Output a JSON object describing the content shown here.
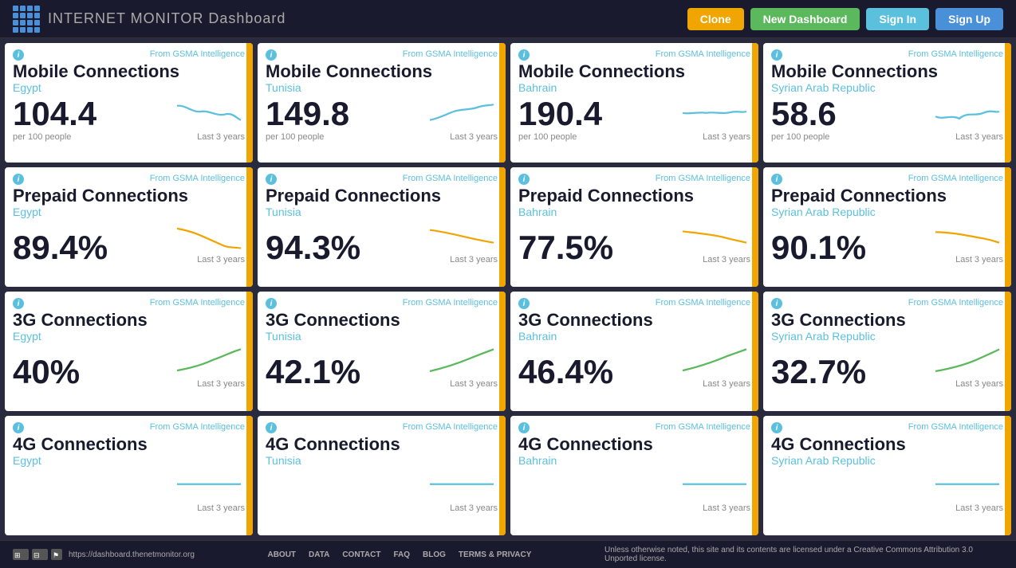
{
  "header": {
    "logo_text": "INTERNET MONITOR",
    "logo_subtitle": " Dashboard",
    "btn_clone": "Clone",
    "btn_new_dashboard": "New Dashboard",
    "btn_sign_in": "Sign In",
    "btn_sign_up": "Sign Up"
  },
  "cards": [
    {
      "source": "From GSMA Intelligence",
      "title": "Mobile Connections",
      "country": "Egypt",
      "value": "104.4",
      "sublabel": "per 100 people",
      "chart_label": "Last 3 years",
      "chart_color": "#5bc0de",
      "chart_type": "wave_down"
    },
    {
      "source": "From GSMA Intelligence",
      "title": "Mobile Connections",
      "country": "Tunisia",
      "value": "149.8",
      "sublabel": "per 100 people",
      "chart_label": "Last 3 years",
      "chart_color": "#5bc0de",
      "chart_type": "wave_up"
    },
    {
      "source": "From GSMA Intelligence",
      "title": "Mobile Connections",
      "country": "Bahrain",
      "value": "190.4",
      "sublabel": "per 100 people",
      "chart_label": "Last 3 years",
      "chart_color": "#5bc0de",
      "chart_type": "wave_flat"
    },
    {
      "source": "From GSMA Intelligence",
      "title": "Mobile Connections",
      "country": "Syrian Arab Republic",
      "value": "58.6",
      "sublabel": "per 100 people",
      "chart_label": "Last 3 years",
      "chart_color": "#5bc0de",
      "chart_type": "wave_updown"
    },
    {
      "source": "From GSMA Intelligence",
      "title": "Prepaid Connections",
      "country": "Egypt",
      "value": "89.4%",
      "sublabel": "",
      "chart_label": "Last 3 years",
      "chart_color": "#f0a500",
      "chart_type": "down_sharp"
    },
    {
      "source": "From GSMA Intelligence",
      "title": "Prepaid Connections",
      "country": "Tunisia",
      "value": "94.3%",
      "sublabel": "",
      "chart_label": "Last 3 years",
      "chart_color": "#f0a500",
      "chart_type": "down_gentle"
    },
    {
      "source": "From GSMA Intelligence",
      "title": "Prepaid Connections",
      "country": "Bahrain",
      "value": "77.5%",
      "sublabel": "",
      "chart_label": "Last 3 years",
      "chart_color": "#f0a500",
      "chart_type": "down_gentle2"
    },
    {
      "source": "From GSMA Intelligence",
      "title": "Prepaid Connections",
      "country": "Syrian Arab Republic",
      "value": "90.1%",
      "sublabel": "",
      "chart_label": "Last 3 years",
      "chart_color": "#f0a500",
      "chart_type": "down_flat"
    },
    {
      "source": "From GSMA Intelligence",
      "title": "3G Connections",
      "country": "Egypt",
      "value": "40%",
      "sublabel": "",
      "chart_label": "Last 3 years",
      "chart_color": "#5cb85c",
      "chart_type": "up_curve"
    },
    {
      "source": "From GSMA Intelligence",
      "title": "3G Connections",
      "country": "Tunisia",
      "value": "42.1%",
      "sublabel": "",
      "chart_label": "Last 3 years",
      "chart_color": "#5cb85c",
      "chart_type": "up_curve2"
    },
    {
      "source": "From GSMA Intelligence",
      "title": "3G Connections",
      "country": "Bahrain",
      "value": "46.4%",
      "sublabel": "",
      "chart_label": "Last 3 years",
      "chart_color": "#5cb85c",
      "chart_type": "up_curve3"
    },
    {
      "source": "From GSMA Intelligence",
      "title": "3G Connections",
      "country": "Syrian Arab Republic",
      "value": "32.7%",
      "sublabel": "",
      "chart_label": "Last 3 years",
      "chart_color": "#5cb85c",
      "chart_type": "up_curve4"
    },
    {
      "source": "From GSMA Intelligence",
      "title": "4G Connections",
      "country": "Egypt",
      "value": "",
      "sublabel": "",
      "chart_label": "Last 3 years",
      "chart_color": "#5bc0de",
      "chart_type": "flat"
    },
    {
      "source": "From GSMA Intelligence",
      "title": "4G Connections",
      "country": "Tunisia",
      "value": "",
      "sublabel": "",
      "chart_label": "Last 3 years",
      "chart_color": "#5bc0de",
      "chart_type": "flat"
    },
    {
      "source": "From GSMA Intelligence",
      "title": "4G Connections",
      "country": "Bahrain",
      "value": "",
      "sublabel": "",
      "chart_label": "Last 3 years",
      "chart_color": "#5bc0de",
      "chart_type": "flat"
    },
    {
      "source": "From GSMA Intelligence",
      "title": "4G Connections",
      "country": "Syrian Arab Republic",
      "value": "",
      "sublabel": "",
      "chart_label": "Last 3 years",
      "chart_color": "#5bc0de",
      "chart_type": "flat"
    }
  ],
  "footer": {
    "url": "https://dashboard.thenetmonitor.org",
    "links": [
      "About",
      "Data",
      "Contact",
      "FAQ",
      "Blog",
      "Terms & Privacy"
    ],
    "license": "Unless otherwise noted, this site and its contents are licensed under a Creative Commons Attribution 3.0 Unported license."
  }
}
